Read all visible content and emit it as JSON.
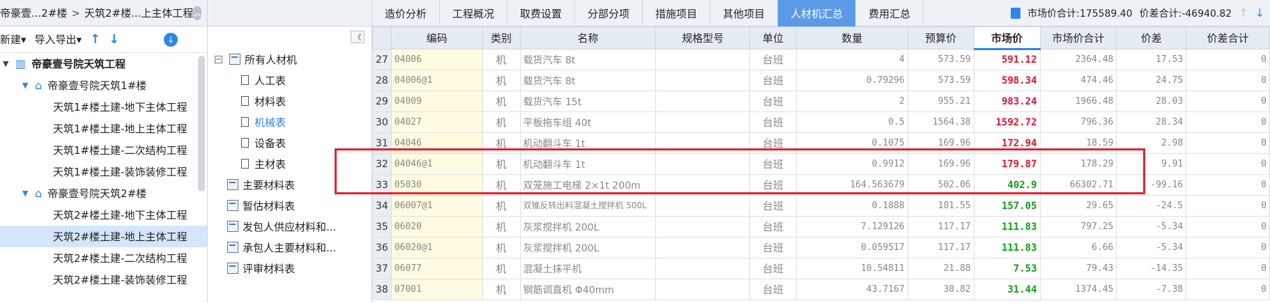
{
  "breadcrumb": {
    "part1": "帝豪壹...2#楼",
    "sep": ">",
    "part2": "天筑2#楼...上主体工程"
  },
  "left_toolbar": {
    "new": "新建",
    "import_export": "导入导出"
  },
  "project_tree": [
    {
      "label": "帝豪壹号院天筑工程",
      "level": 0,
      "kind": "root"
    },
    {
      "label": "帝豪壹号院天筑1#楼",
      "level": 1,
      "kind": "building"
    },
    {
      "label": "天筑1#楼土建-地下主体工程",
      "level": 2
    },
    {
      "label": "天筑1#楼土建-地上主体工程",
      "level": 2
    },
    {
      "label": "天筑1#楼土建-二次结构工程",
      "level": 2
    },
    {
      "label": "天筑1#楼土建-装饰装修工程",
      "level": 2
    },
    {
      "label": "帝豪壹号院天筑2#楼",
      "level": 1,
      "kind": "building"
    },
    {
      "label": "天筑2#楼土建-地下主体工程",
      "level": 2
    },
    {
      "label": "天筑2#楼土建-地上主体工程",
      "level": 2,
      "selected": true
    },
    {
      "label": "天筑2#楼土建-二次结构工程",
      "level": 2
    },
    {
      "label": "天筑2#楼土建-装饰装修工程",
      "level": 2
    }
  ],
  "material_tree": {
    "root": "所有人材机",
    "children": [
      "人工表",
      "材料表",
      "机械表",
      "设备表",
      "主材表"
    ],
    "others": [
      "主要材料表",
      "暂估材料表",
      "发包人供应材料和...",
      "承包人主要材料和...",
      "评审材料表"
    ]
  },
  "tabs": [
    "造价分析",
    "工程概况",
    "取费设置",
    "分部分项",
    "措施项目",
    "其他项目",
    "人材机汇总",
    "费用汇总"
  ],
  "active_tab": "人材机汇总",
  "totals": {
    "market_total": "市场价合计:175589.40",
    "diff_total": "价差合计:-46940.82"
  },
  "columns": [
    "编码",
    "类别",
    "名称",
    "规格型号",
    "单位",
    "数量",
    "预算价",
    "市场价",
    "市场价合计",
    "价差",
    "价差合计"
  ],
  "rows": [
    {
      "idx": "27",
      "code": "04006",
      "cat": "机",
      "name": "载货汽车 8t",
      "spec": "",
      "unit": "台班",
      "qty": "4",
      "budget": "573.59",
      "market": "591.12",
      "mcolor": "red",
      "mtotal": "2364.48",
      "diff": "17.53",
      "dtotal": "0"
    },
    {
      "idx": "28",
      "code": "04006@1",
      "cat": "机",
      "name": "载货汽车 8t",
      "spec": "",
      "unit": "台班",
      "qty": "0.79296",
      "budget": "573.59",
      "market": "598.34",
      "mcolor": "red",
      "mtotal": "474.46",
      "diff": "24.75",
      "dtotal": "0"
    },
    {
      "idx": "29",
      "code": "04009",
      "cat": "机",
      "name": "载货汽车 15t",
      "spec": "",
      "unit": "台班",
      "qty": "2",
      "budget": "955.21",
      "market": "983.24",
      "mcolor": "red",
      "mtotal": "1966.48",
      "diff": "28.03",
      "dtotal": "0"
    },
    {
      "idx": "30",
      "code": "04027",
      "cat": "机",
      "name": "平板拖车组 40t",
      "spec": "",
      "unit": "台班",
      "qty": "0.5",
      "budget": "1564.38",
      "market": "1592.72",
      "mcolor": "red",
      "mtotal": "796.36",
      "diff": "28.34",
      "dtotal": "0"
    },
    {
      "idx": "31",
      "code": "04046",
      "cat": "机",
      "name": "机动翻斗车 1t",
      "spec": "",
      "unit": "台班",
      "qty": "0.1075",
      "budget": "169.96",
      "market": "172.94",
      "mcolor": "red",
      "mtotal": "18.59",
      "diff": "2.98",
      "dtotal": "0"
    },
    {
      "idx": "32",
      "code": "04046@1",
      "cat": "机",
      "name": "机动翻斗车 1t",
      "spec": "",
      "unit": "台班",
      "qty": "0.9912",
      "budget": "169.96",
      "market": "179.87",
      "mcolor": "red",
      "mtotal": "178.29",
      "diff": "9.91",
      "dtotal": "0"
    },
    {
      "idx": "33",
      "code": "05030",
      "cat": "机",
      "name": "双笼施工电梯 2×1t 200m",
      "spec": "",
      "unit": "台班",
      "qty": "164.563679",
      "budget": "502.06",
      "market": "402.9",
      "mcolor": "green",
      "mtotal": "66302.71",
      "diff": "-99.16",
      "dtotal": "0"
    },
    {
      "idx": "34",
      "code": "06007@1",
      "cat": "机",
      "name": "双锥反转出料混凝土搅拌机 500L",
      "spec": "",
      "unit": "台班",
      "qty": "0.1888",
      "budget": "181.55",
      "market": "157.05",
      "mcolor": "green",
      "mtotal": "29.65",
      "diff": "-24.5",
      "dtotal": "0"
    },
    {
      "idx": "35",
      "code": "06020",
      "cat": "机",
      "name": "灰浆搅拌机 200L",
      "spec": "",
      "unit": "台班",
      "qty": "7.129126",
      "budget": "117.17",
      "market": "111.83",
      "mcolor": "green",
      "mtotal": "797.25",
      "diff": "-5.34",
      "dtotal": "0"
    },
    {
      "idx": "36",
      "code": "06020@1",
      "cat": "机",
      "name": "灰浆搅拌机 200L",
      "spec": "",
      "unit": "台班",
      "qty": "0.059517",
      "budget": "117.17",
      "market": "111.83",
      "mcolor": "green",
      "mtotal": "6.66",
      "diff": "-5.34",
      "dtotal": "0"
    },
    {
      "idx": "37",
      "code": "06077",
      "cat": "机",
      "name": "混凝土抹平机",
      "spec": "",
      "unit": "台班",
      "qty": "10.54811",
      "budget": "21.88",
      "market": "7.53",
      "mcolor": "green",
      "mtotal": "79.43",
      "diff": "-14.35",
      "dtotal": "0"
    },
    {
      "idx": "38",
      "code": "07001",
      "cat": "机",
      "name": "钢筋调直机 Φ40mm",
      "spec": "",
      "unit": "台班",
      "qty": "43.7167",
      "budget": "38.82",
      "market": "31.44",
      "mcolor": "green",
      "mtotal": "1374.45",
      "diff": "-7.38",
      "dtotal": "0"
    }
  ],
  "colors": {
    "accent": "#2f86e8",
    "active_tab": "#5b9ae6",
    "highlight_box": "#e8202a",
    "price_up": "#e8102a",
    "price_down": "#0aa214"
  }
}
